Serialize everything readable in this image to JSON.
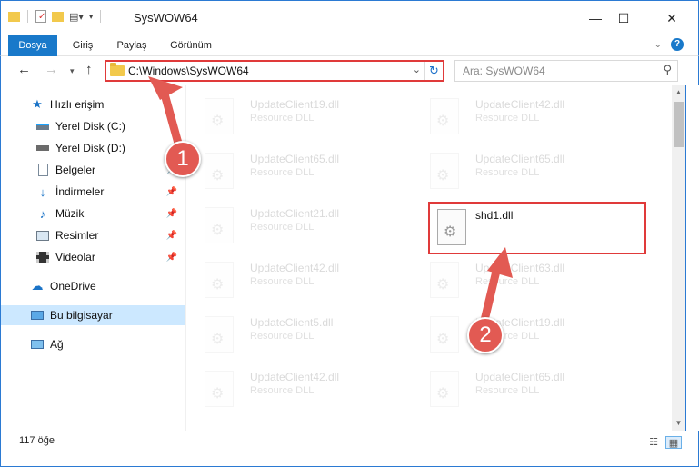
{
  "window": {
    "title": "SysWOW64",
    "minimize": "—",
    "maximize": "☐",
    "close": "✕"
  },
  "ribbon": {
    "tabs": [
      "Dosya",
      "Giriş",
      "Paylaş",
      "Görünüm"
    ]
  },
  "address": {
    "path": "C:\\Windows\\SysWOW64",
    "search_placeholder": "Ara: SysWOW64"
  },
  "sidebar": {
    "items": [
      {
        "label": "Hızlı erişim",
        "icon": "star-icon"
      },
      {
        "label": "Yerel Disk (C:)",
        "icon": "drive-icon"
      },
      {
        "label": "Yerel Disk (D:)",
        "icon": "drive-icon"
      },
      {
        "label": "Belgeler",
        "icon": "documents-icon"
      },
      {
        "label": "İndirmeler",
        "icon": "download-icon"
      },
      {
        "label": "Müzik",
        "icon": "music-icon"
      },
      {
        "label": "Resimler",
        "icon": "pictures-icon"
      },
      {
        "label": "Videolar",
        "icon": "videos-icon"
      },
      {
        "label": "OneDrive",
        "icon": "cloud-icon"
      },
      {
        "label": "Bu bilgisayar",
        "icon": "computer-icon"
      },
      {
        "label": "Ağ",
        "icon": "network-icon"
      }
    ]
  },
  "files": {
    "left": [
      {
        "name": "UpdateClient19.dll",
        "type": "Resource DLL"
      },
      {
        "name": "UpdateClient65.dll",
        "type": "Resource DLL"
      },
      {
        "name": "UpdateClient21.dll",
        "type": "Resource DLL"
      },
      {
        "name": "UpdateClient42.dll",
        "type": "Resource DLL"
      },
      {
        "name": "UpdateClient5.dll",
        "type": "Resource DLL"
      },
      {
        "name": "UpdateClient42.dll",
        "type": "Resource DLL"
      }
    ],
    "right": [
      {
        "name": "UpdateClient42.dll",
        "type": "Resource DLL"
      },
      {
        "name": "UpdateClient65.dll",
        "type": "Resource DLL"
      },
      {
        "name": "shd1.dll",
        "type": ""
      },
      {
        "name": "UpdateClient63.dll",
        "type": "Resource DLL"
      },
      {
        "name": "UpdateClient19.dll",
        "type": "Resource DLL"
      },
      {
        "name": "UpdateClient65.dll",
        "type": "Resource DLL"
      }
    ]
  },
  "status": {
    "count": "117 öğe"
  },
  "annotations": {
    "step1": "1",
    "step2": "2",
    "color": "#e25a53"
  }
}
